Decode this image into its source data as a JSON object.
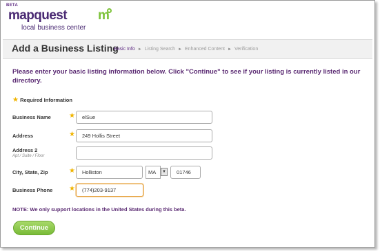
{
  "logo": {
    "beta": "BETA",
    "brand": "mapquest",
    "mark": "m",
    "subtitle": "local business center"
  },
  "page_title": "Add a Business Listing",
  "breadcrumb": [
    {
      "label": "Basic Info",
      "active": true
    },
    {
      "label": "Listing Search",
      "active": false
    },
    {
      "label": "Enhanced Content",
      "active": false
    },
    {
      "label": "Verification",
      "active": false
    }
  ],
  "intro": "Please enter your basic listing information below. Click \"Continue\" to see if your listing is currently listed in our directory.",
  "required_info": "Required Information",
  "form": {
    "business_name": {
      "label": "Business Name",
      "value": "elSue"
    },
    "address": {
      "label": "Address",
      "value": "249 Hollis Street"
    },
    "address2": {
      "label": "Address 2",
      "hint": "Apt / Suite / Floor",
      "value": ""
    },
    "city_state_zip": {
      "label": "City, State, Zip",
      "city": "Holliston",
      "state": "MA",
      "zip": "01746"
    },
    "phone": {
      "label": "Business Phone",
      "value": "(774)203-9137"
    }
  },
  "note": "NOTE: We only support locations in the United States during this beta.",
  "continue_label": "Continue",
  "colors": {
    "brand_purple": "#4a2a73",
    "accent_green": "#7cc238",
    "required_star": "#f0b400"
  }
}
